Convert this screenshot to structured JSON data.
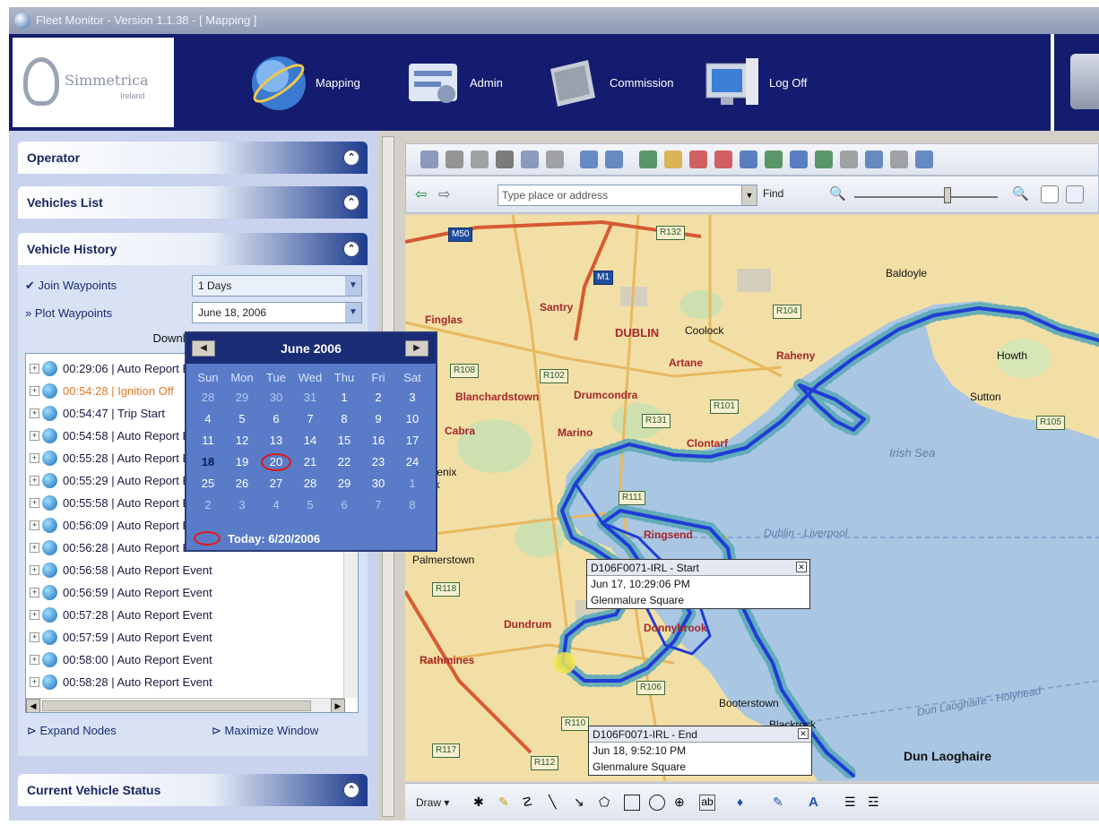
{
  "window": {
    "title": "Fleet Monitor - Version 1.1.38 - [ Mapping ]"
  },
  "logo": {
    "brand": "Simmetrica",
    "sub": "Ireland"
  },
  "nav": [
    {
      "label": "Mapping",
      "icon": "globe-icon"
    },
    {
      "label": "Admin",
      "icon": "admin-icon"
    },
    {
      "label": "Commission",
      "icon": "commission-icon"
    },
    {
      "label": "Log Off",
      "icon": "logoff-icon"
    }
  ],
  "panels": {
    "operator": "Operator",
    "vehicles_list": "Vehicles List",
    "vehicle_history": "Vehicle History",
    "current_status": "Current Vehicle Status"
  },
  "history": {
    "join_label": "Join Waypoints",
    "join_value": "1 Days",
    "plot_label": "Plot Waypoints",
    "plot_value": "June 18, 2006",
    "download": "Download Data"
  },
  "tree_items": [
    "00:29:06 | Auto Report Event",
    "00:54:28 | Ignition Off",
    "00:54:47 | Trip Start",
    "00:54:58 | Auto Report Event",
    "00:55:28 | Auto Report Event",
    "00:55:29 | Auto Report Event",
    "00:55:58 | Auto Report Event",
    "00:56:09 | Auto Report Event",
    "00:56:28 | Auto Report Event",
    "00:56:58 | Auto Report Event",
    "00:56:59 | Auto Report Event",
    "00:57:28 | Auto Report Event",
    "00:57:59 | Auto Report Event",
    "00:58:00 | Auto Report Event",
    "00:58:28 | Auto Report Event"
  ],
  "links": {
    "expand": "Expand Nodes",
    "maximize": "Maximize Window"
  },
  "calendar": {
    "month": "June 2006",
    "dow": [
      "Sun",
      "Mon",
      "Tue",
      "Wed",
      "Thu",
      "Fri",
      "Sat"
    ],
    "weeks": [
      [
        "28",
        "29",
        "30",
        "31",
        "1",
        "2",
        "3"
      ],
      [
        "4",
        "5",
        "6",
        "7",
        "8",
        "9",
        "10"
      ],
      [
        "11",
        "12",
        "13",
        "14",
        "15",
        "16",
        "17"
      ],
      [
        "18",
        "19",
        "20",
        "21",
        "22",
        "23",
        "24"
      ],
      [
        "25",
        "26",
        "27",
        "28",
        "29",
        "30",
        "1"
      ],
      [
        "2",
        "3",
        "4",
        "5",
        "6",
        "7",
        "8"
      ]
    ],
    "today": "Today: 6/20/2006"
  },
  "toolbar": {
    "search_placeholder": "Type place or address",
    "find": "Find"
  },
  "map_labels": {
    "towns": [
      "Baldoyle",
      "Santry",
      "Coolock",
      "Finglas",
      "Artane",
      "Raheny",
      "Sutton",
      "Blanchardstown",
      "Drumcondra",
      "Marino",
      "Clontarf",
      "Cabra",
      "Phoenix Park",
      "Ringsend",
      "Palmerstown",
      "Rathmines",
      "Dundrum",
      "Blackrock",
      "Dun Laoghaire",
      "Howth",
      "Booterstown",
      "Donnybrook"
    ],
    "dublin": "DUBLIN",
    "sea": "Irish Sea",
    "ferry_routes": [
      "Dublin - Liverpool",
      "Dun Laoghaire - Holyhead"
    ],
    "roads": [
      "R132",
      "M1",
      "R104",
      "R105",
      "R102",
      "R101",
      "R131",
      "R111",
      "R118",
      "R110",
      "R112",
      "R106",
      "R117",
      "M50",
      "R108"
    ]
  },
  "callouts": [
    {
      "title": "D106F0071-IRL - Start",
      "time": "Jun 17, 10:29:06 PM",
      "place": "Glenmalure Square"
    },
    {
      "title": "D106F0071-IRL - End",
      "time": "Jun 18, 9:52:10 PM",
      "place": "Glenmalure Square"
    }
  ],
  "drawbar": {
    "label": "Draw"
  },
  "colors": {
    "header": "#131c6e",
    "route": "#1f3cd6",
    "water": "#a9c6e2",
    "land": "#f2dfa6"
  }
}
